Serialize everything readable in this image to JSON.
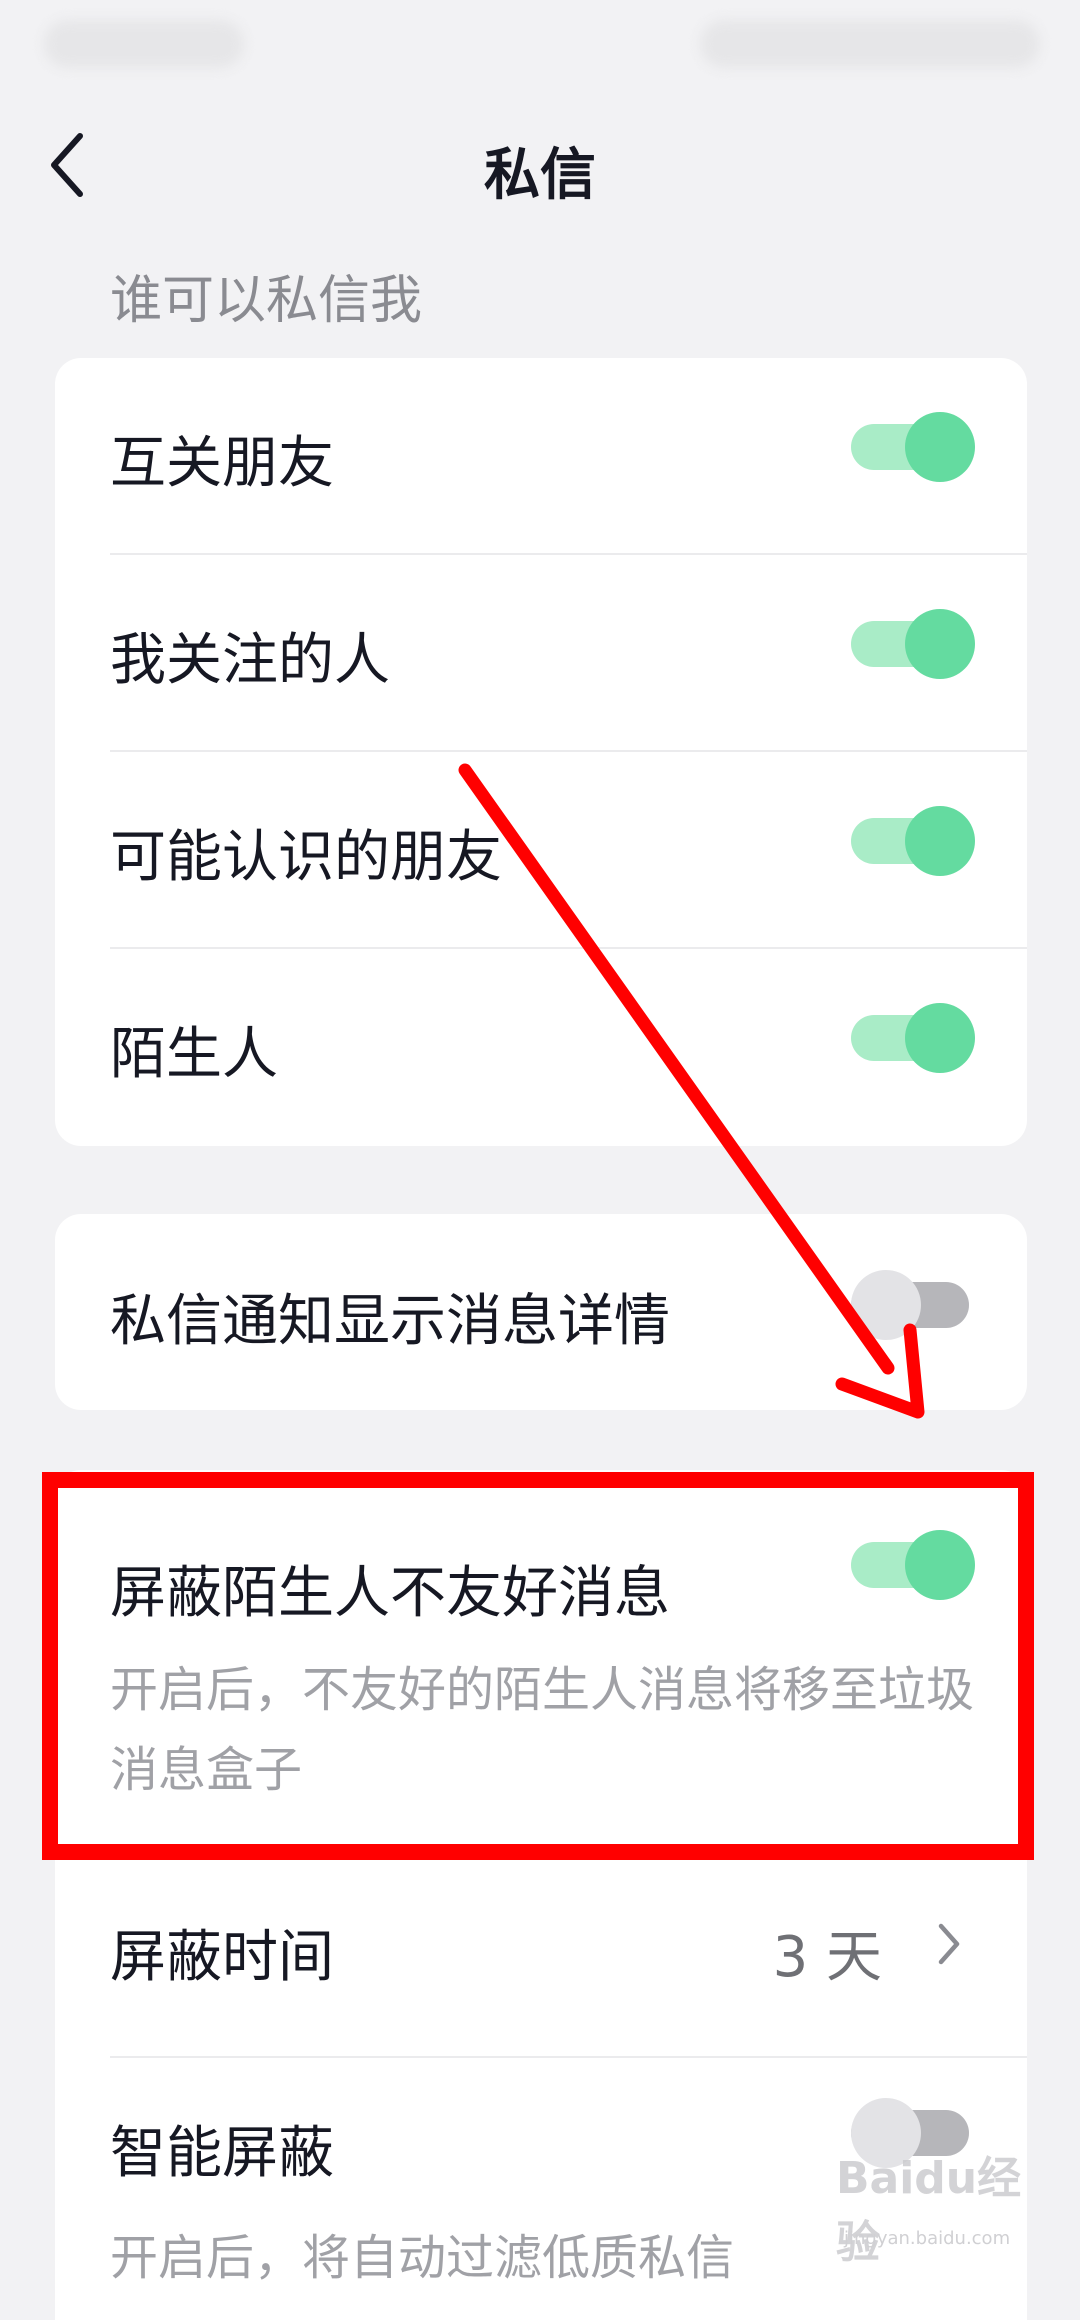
{
  "header": {
    "title": "私信"
  },
  "section": {
    "who_can_message": "谁可以私信我"
  },
  "permissions": [
    {
      "label": "互关朋友",
      "enabled": true
    },
    {
      "label": "我关注的人",
      "enabled": true
    },
    {
      "label": "可能认识的朋友",
      "enabled": true
    },
    {
      "label": "陌生人",
      "enabled": true
    }
  ],
  "notification": {
    "label": "私信通知显示消息详情",
    "enabled": false
  },
  "block_unfriendly": {
    "label": "屏蔽陌生人不友好消息",
    "description": "开启后，不友好的陌生人消息将移至垃圾消息盒子",
    "enabled": true
  },
  "block_time": {
    "label": "屏蔽时间",
    "value": "3 天"
  },
  "smart_block": {
    "label": "智能屏蔽",
    "description": "开启后，将自动过滤低质私信",
    "enabled": false
  },
  "watermark": {
    "text": "Baidu经验",
    "sub": "jingyan.baidu.com"
  },
  "colors": {
    "toggle_on_knob": "#64dba0",
    "toggle_on_track": "#a9ecc7",
    "toggle_off_knob": "#e3e3e6",
    "toggle_off_track": "#b6b6ba",
    "annotation_red": "#ff0000"
  }
}
